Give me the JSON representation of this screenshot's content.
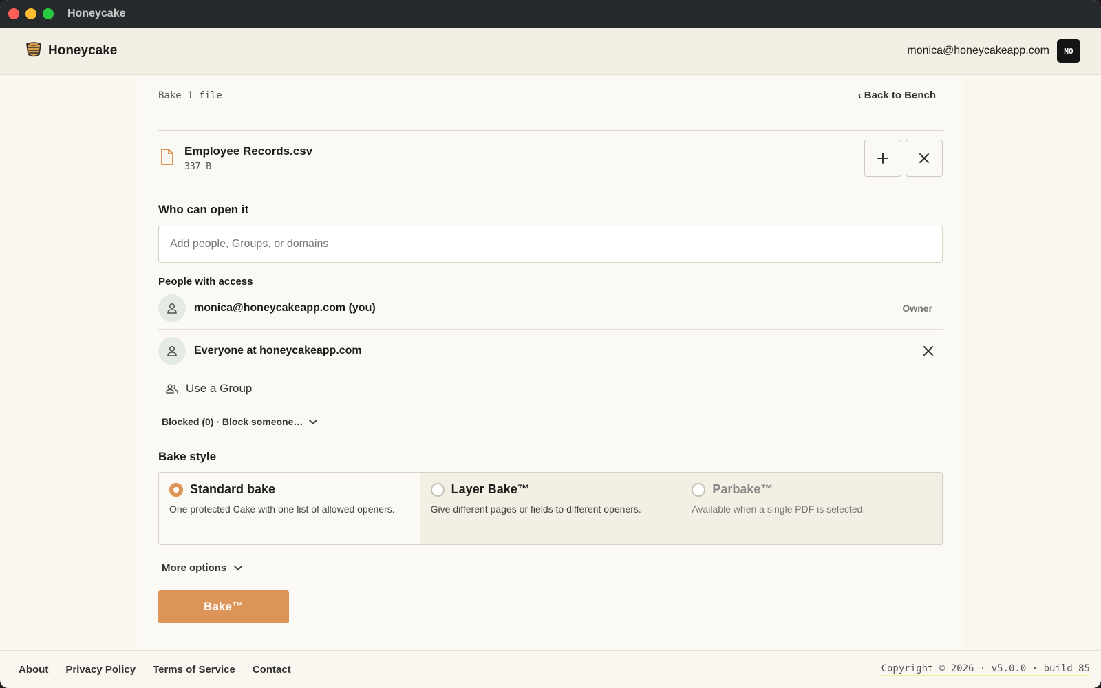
{
  "window": {
    "title": "Honeycake"
  },
  "header": {
    "brand": "Honeycake",
    "user_email": "monica@honeycakeapp.com",
    "avatar_initials": "MO"
  },
  "panel": {
    "crumb": "Bake 1 file",
    "back_label": "‹ Back to Bench"
  },
  "file": {
    "name": "Employee Records.csv",
    "size": "337 B"
  },
  "access": {
    "title": "Who can open it",
    "input_placeholder": "Add people, Groups, or domains",
    "people_title": "People with access",
    "people": [
      {
        "name": "monica@honeycakeapp.com (you)",
        "role": "Owner"
      },
      {
        "name": "Everyone at honeycakeapp.com"
      }
    ],
    "group_label": "Use a Group",
    "blocked_label": "Blocked (0) · Block someone…"
  },
  "bake_style": {
    "title": "Bake style",
    "options": [
      {
        "title": "Standard bake",
        "desc": "One protected Cake with one list of allowed openers.",
        "selected": true
      },
      {
        "title": "Layer Bake™",
        "desc": "Give different pages or fields to different openers.",
        "selected": false
      },
      {
        "title": "Parbake™",
        "desc": "Available when a single PDF is selected.",
        "selected": false,
        "disabled": true
      }
    ]
  },
  "more_options_label": "More options",
  "bake_button": "Bake™",
  "footer": {
    "links": [
      "About",
      "Privacy Policy",
      "Terms of Service",
      "Contact"
    ],
    "copyright": "Copyright © 2026 · v5.0.0 · build 85"
  },
  "colors": {
    "accent": "#dd9458",
    "titlebar": "#262a2c",
    "background": "#faf7f0"
  }
}
